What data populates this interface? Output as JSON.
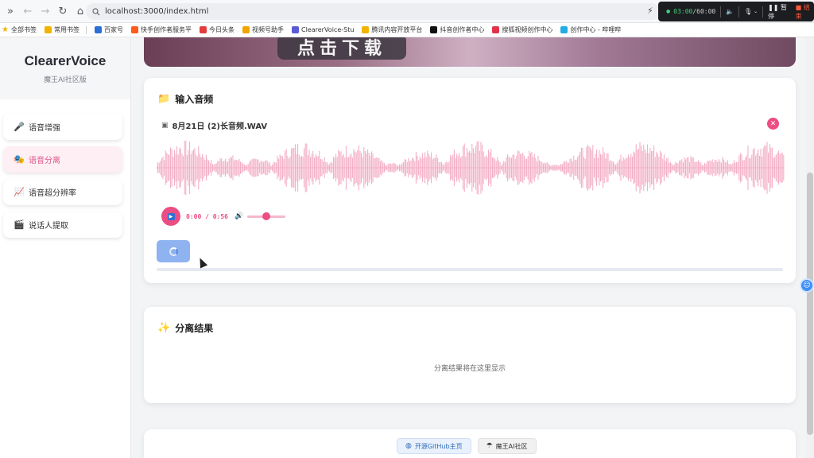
{
  "browser": {
    "url": "localhost:3000/index.html",
    "bookmarks": [
      {
        "label": "全部书签",
        "icon": "star-icon",
        "color": "#f2b300"
      },
      {
        "label": "常用书签",
        "icon": "bookmark-folder-icon",
        "color": "#f2b300"
      },
      {
        "label": "百家号",
        "icon": "baijiahao-icon",
        "color": "#2c6fd9"
      },
      {
        "label": "快手创作者服务平",
        "icon": "kuaishou-icon",
        "color": "#ff5b1a"
      },
      {
        "label": "今日头条",
        "icon": "toutiao-icon",
        "color": "#e23d3d"
      },
      {
        "label": "视频号助手",
        "icon": "channels-icon",
        "color": "#f2a400"
      },
      {
        "label": "ClearerVoice-Stu",
        "icon": "clearervoice-icon",
        "color": "#5b5bd6"
      },
      {
        "label": "腾讯内容开放平台",
        "icon": "tencent-icon",
        "color": "#f2b300"
      },
      {
        "label": "抖音创作者中心",
        "icon": "douyin-icon",
        "color": "#111111"
      },
      {
        "label": "搜狐视频创作中心",
        "icon": "sohu-icon",
        "color": "#e2334a"
      },
      {
        "label": "创作中心 - 哔哩哔",
        "icon": "bilibili-icon",
        "color": "#23ade5"
      }
    ]
  },
  "recorder": {
    "elapsed": "03:00",
    "total": "/60:00",
    "pause_label": "暂停",
    "stop_label": "结束"
  },
  "sidebar": {
    "title": "ClearerVoice",
    "subtitle": "魔王AI社区版",
    "items": [
      {
        "label": "语音增强",
        "icon": "microphone-icon",
        "active": false
      },
      {
        "label": "语音分离",
        "icon": "masks-icon",
        "active": true
      },
      {
        "label": "语音超分辨率",
        "icon": "chart-up-icon",
        "active": false
      },
      {
        "label": "说话人提取",
        "icon": "clapper-icon",
        "active": false
      }
    ]
  },
  "banner": {
    "button_label": "点击下载"
  },
  "input_card": {
    "title": "输入音频",
    "file_name": "8月21日 (2)长音频.WAV",
    "player": {
      "current_time": "0:00",
      "duration": "0:56",
      "volume": 0.5
    },
    "progress": 0
  },
  "result_card": {
    "title": "分离结果",
    "empty_text": "分离结果将在这里显示"
  },
  "footer": {
    "github_label": "开源GitHub主页",
    "community_label": "魔王AI社区"
  },
  "colors": {
    "accent": "#ec4d82",
    "waveform": "#f2a7c1",
    "process_button": "#8fb3f0"
  }
}
